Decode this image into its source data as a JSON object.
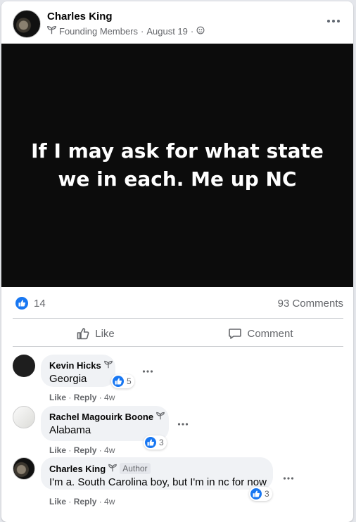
{
  "post": {
    "author": "Charles King",
    "group_badge": "Founding Members",
    "date": "August 19",
    "separator": "·",
    "image_text": "If I may ask for what state we in each. Me up NC",
    "reactions_count": "14",
    "comments_count": "93 Comments",
    "like_label": "Like",
    "comment_label": "Comment"
  },
  "comments": [
    {
      "name": "Kevin Hicks",
      "text": "Georgia",
      "reactions": "5",
      "like": "Like",
      "reply": "Reply",
      "time": "4w",
      "author_tag": ""
    },
    {
      "name": "Rachel Magouirk Boone",
      "text": "Alabama",
      "reactions": "3",
      "like": "Like",
      "reply": "Reply",
      "time": "4w",
      "author_tag": ""
    },
    {
      "name": "Charles King",
      "text": "I'm a. South Carolina boy, but I'm in nc for now",
      "reactions": "3",
      "like": "Like",
      "reply": "Reply",
      "time": "4w",
      "author_tag": "Author"
    }
  ],
  "icons": {
    "badge": "sprout-icon",
    "audience": "globe-icon",
    "reaction": "thumbs-up-icon",
    "more": "more-horizontal-icon"
  },
  "colors": {
    "accent": "#1877f2",
    "image_background": "#0c0c0c",
    "secondary_text": "#65676b"
  }
}
